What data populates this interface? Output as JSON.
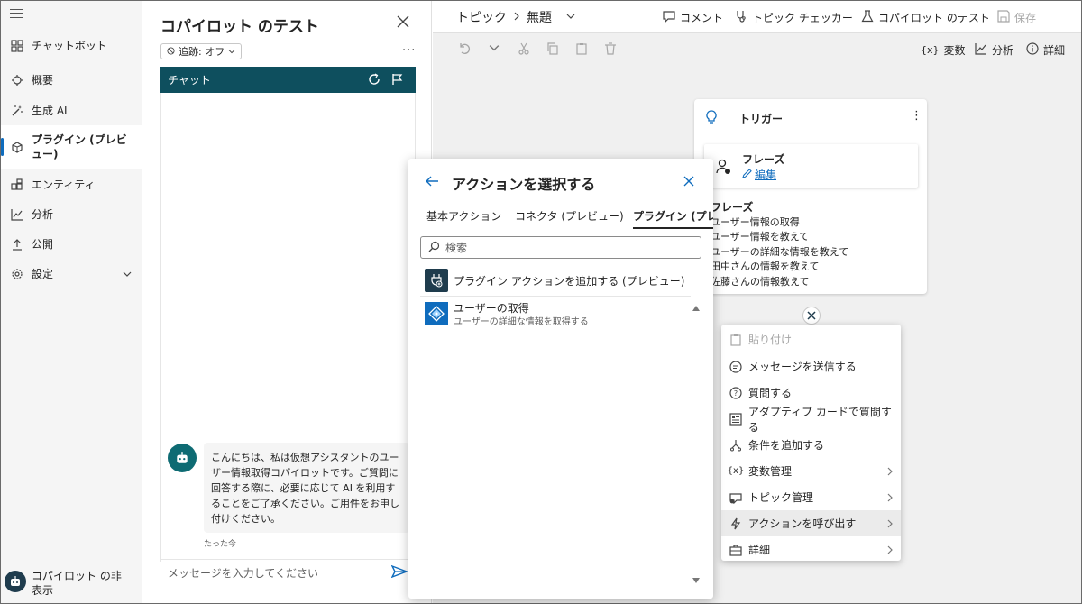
{
  "sidebar": {
    "items": [
      {
        "label": "チャットボット",
        "icon": "grid-icon"
      },
      {
        "label": "概要",
        "icon": "overview-icon"
      },
      {
        "label": "生成 AI",
        "icon": "magic-wand-icon"
      },
      {
        "label": "プラグイン (プレビュー)",
        "icon": "plugin-icon"
      },
      {
        "label": "エンティティ",
        "icon": "entity-icon"
      },
      {
        "label": "分析",
        "icon": "chart-icon"
      },
      {
        "label": "公開",
        "icon": "upload-icon"
      },
      {
        "label": "設定",
        "icon": "gear-icon"
      }
    ],
    "footer_label": "コパイロット の非表示"
  },
  "test_panel": {
    "title": "コパイロット のテスト",
    "track_label": "追跡: オフ",
    "chat_header": "チャット",
    "bot_message": "こんにちは、私は仮想アシスタントのユーザー情報取得コパイロットです。ご質問に回答する際に、必要に応じて AI を利用することをご了承ください。ご用件をお申し付けください。",
    "message_time": "たった今",
    "input_placeholder": "メッセージを入力してください"
  },
  "topbar": {
    "breadcrumb_root": "トピック",
    "breadcrumb_current": "無題",
    "comment": "コメント",
    "topic_checker": "トピック チェッカー",
    "copilot_test": "コパイロット のテスト",
    "save": "保存"
  },
  "toolbar2": {
    "variables": "変数",
    "analytics": "分析",
    "details": "詳細"
  },
  "trigger": {
    "title": "トリガー",
    "phrase_box_title": "フレーズ",
    "edit_label": "編集",
    "phrases_title": "フレーズ",
    "phrases": [
      "ユーザー情報の取得",
      "ユーザー情報を教えて",
      "ユーザーの詳細な情報を教えて",
      "田中さんの情報を教えて",
      "佐藤さんの情報教えて"
    ]
  },
  "menu": {
    "items": [
      {
        "label": "貼り付け",
        "icon": "paste-icon",
        "disabled": true
      },
      {
        "label": "メッセージを送信する",
        "icon": "message-icon"
      },
      {
        "label": "質問する",
        "icon": "question-icon"
      },
      {
        "label": "アダプティブ カードで質問する",
        "icon": "card-icon"
      },
      {
        "label": "条件を追加する",
        "icon": "branch-icon"
      },
      {
        "label": "変数管理",
        "icon": "variable-icon",
        "submenu": true
      },
      {
        "label": "トピック管理",
        "icon": "topic-icon",
        "submenu": true
      },
      {
        "label": "アクションを呼び出す",
        "icon": "lightning-icon",
        "submenu": true,
        "highlighted": true
      },
      {
        "label": "詳細",
        "icon": "briefcase-icon",
        "submenu": true
      }
    ]
  },
  "dialog": {
    "title": "アクションを選択する",
    "tabs": [
      "基本アクション",
      "コネクタ (プレビュー)",
      "プラグイン (プレビュー)"
    ],
    "active_tab": 2,
    "search_placeholder": "検索",
    "add_plugin_action": "プラグイン アクションを追加する (プレビュー)",
    "user_item_title": "ユーザーの取得",
    "user_item_desc": "ユーザーの詳細な情報を取得する"
  }
}
